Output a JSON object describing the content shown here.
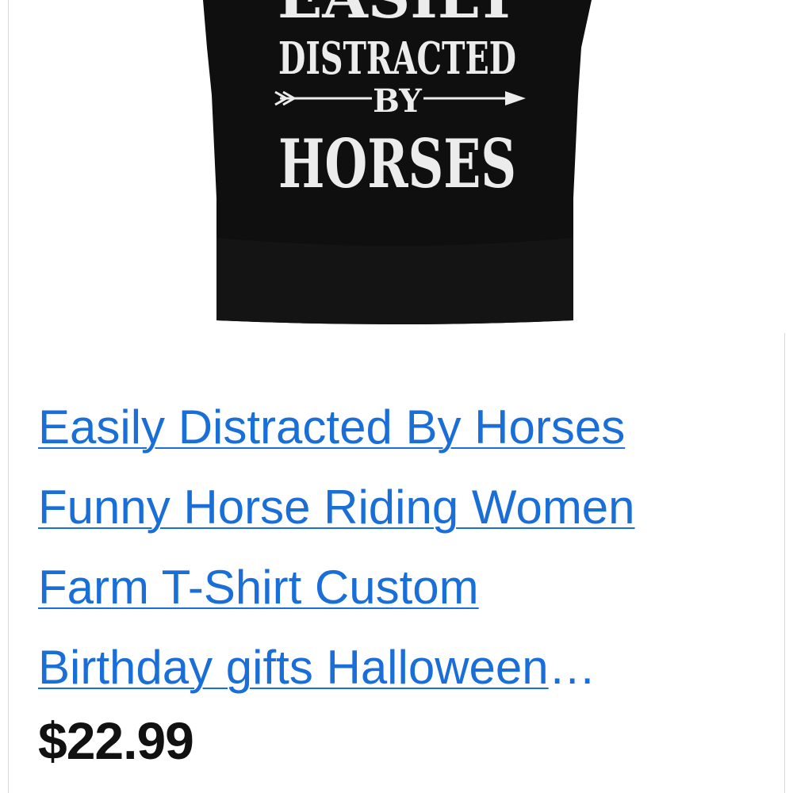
{
  "product": {
    "image_alt": "Black t-shirt with white distressed lettering",
    "shirt_print": {
      "line1": "EASILY",
      "line2": "DISTRACTED",
      "line3": "BY",
      "line4": "HORSES"
    },
    "title_lines": [
      "Easily Distracted By Horses",
      "Funny Horse Riding Women",
      "Farm T-Shirt Custom",
      "Birthday gifts Halloween"
    ],
    "title_ellipsis": "…",
    "price": "$22.99"
  },
  "colors": {
    "link": "#1a6ed8",
    "shirt": "#0f0f0f",
    "print": "#ececec",
    "price": "#111111"
  }
}
